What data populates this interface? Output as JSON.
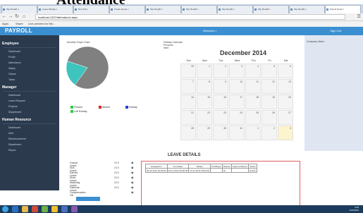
{
  "top_heading": "Attendance",
  "browser": {
    "tabs": [
      "http://localh x",
      "Leave Module x",
      "New Tab x",
      "Create Group x",
      "http://localh x",
      "http://localh x",
      "http://localh x",
      "http://localh x",
      "http://localh x",
      "Payroll Syste x"
    ],
    "url": "localhost:1337/attendance.aspx",
    "bookmarks": [
      "Apps",
      "Share",
      "Live preview for We..."
    ]
  },
  "header": {
    "brand": "PAYROLL",
    "welcome": "Welcome |",
    "signout": "Sign Out"
  },
  "sidebar": {
    "sections": [
      {
        "title": "Employee",
        "items": [
          "Dashboard",
          "Profile",
          "Attendance",
          "Salary",
          "Claims",
          "Taxes"
        ]
      },
      {
        "title": "Manager",
        "items": [
          "Dashboard",
          "Leave Request",
          "Projects",
          "Department"
        ]
      },
      {
        "title": "Human Resource",
        "items": [
          "Dashboard",
          "Alert",
          "Reimbursement",
          "Department",
          "Report"
        ]
      }
    ]
  },
  "graph": {
    "title": "Monthly Graph Chart",
    "legend": [
      {
        "label": "Present",
        "color": "#2ecc40"
      },
      {
        "label": "Absent",
        "color": "#e02020"
      },
      {
        "label": "Holiday",
        "color": "#1f3fd8"
      },
      {
        "label": "Left Holiday",
        "color": "#2ecc40"
      }
    ]
  },
  "chart_data": {
    "type": "pie",
    "title": "Monthly Graph Chart",
    "slices": [
      {
        "label": "",
        "value": 80,
        "color": "#808080"
      },
      {
        "label": "",
        "value": 20,
        "color": "#3cc4bd"
      }
    ]
  },
  "calendar": {
    "title_lines": [
      "Holiday Calendar",
      "Previous",
      "Next"
    ],
    "month": "December 2014",
    "weekdays": [
      "Sun",
      "Mon",
      "Tue",
      "Wed",
      "Thu",
      "Fri",
      "Sat"
    ],
    "days": [
      "30",
      "1",
      "2",
      "3",
      "4",
      "5",
      "6",
      "7",
      "8",
      "9",
      "10",
      "11",
      "12",
      "13",
      "14",
      "15",
      "16",
      "17",
      "18",
      "19",
      "20",
      "21",
      "22",
      "23",
      "24",
      "25",
      "26",
      "27",
      "28",
      "29",
      "30",
      "31",
      "1",
      "2",
      "3"
    ],
    "today": "3"
  },
  "news": {
    "title": "Company News"
  },
  "leave": {
    "title": "LEAVE DETAILS",
    "types": [
      {
        "label": "Casual Leave",
        "value": "2/10"
      },
      {
        "label": "Sick Leave",
        "value": "2/10"
      },
      {
        "label": "Earned Leave",
        "value": "2/10"
      },
      {
        "label": "Short Leave",
        "value": "0/10"
      },
      {
        "label": "Maternity Leave",
        "value": "0/10"
      },
      {
        "label": "Paternity Leave",
        "value": "0/10"
      },
      {
        "label": "Compensation Off",
        "value": ""
      }
    ],
    "table": {
      "headers": [
        "RequestOn",
        "FromDate",
        "ToDate",
        "NoOfDays",
        "Reason",
        "ApprovedName",
        "Status"
      ],
      "rows": [
        [
          "09-11-2014 00:00:00",
          "09-11-2014 00:00:00",
          "13-11-2014 00:00:00",
          "",
          "ok",
          "",
          "broken"
        ]
      ]
    }
  },
  "taskbar": {
    "clock_time": "3:05",
    "clock_date": "12/3/2014"
  }
}
